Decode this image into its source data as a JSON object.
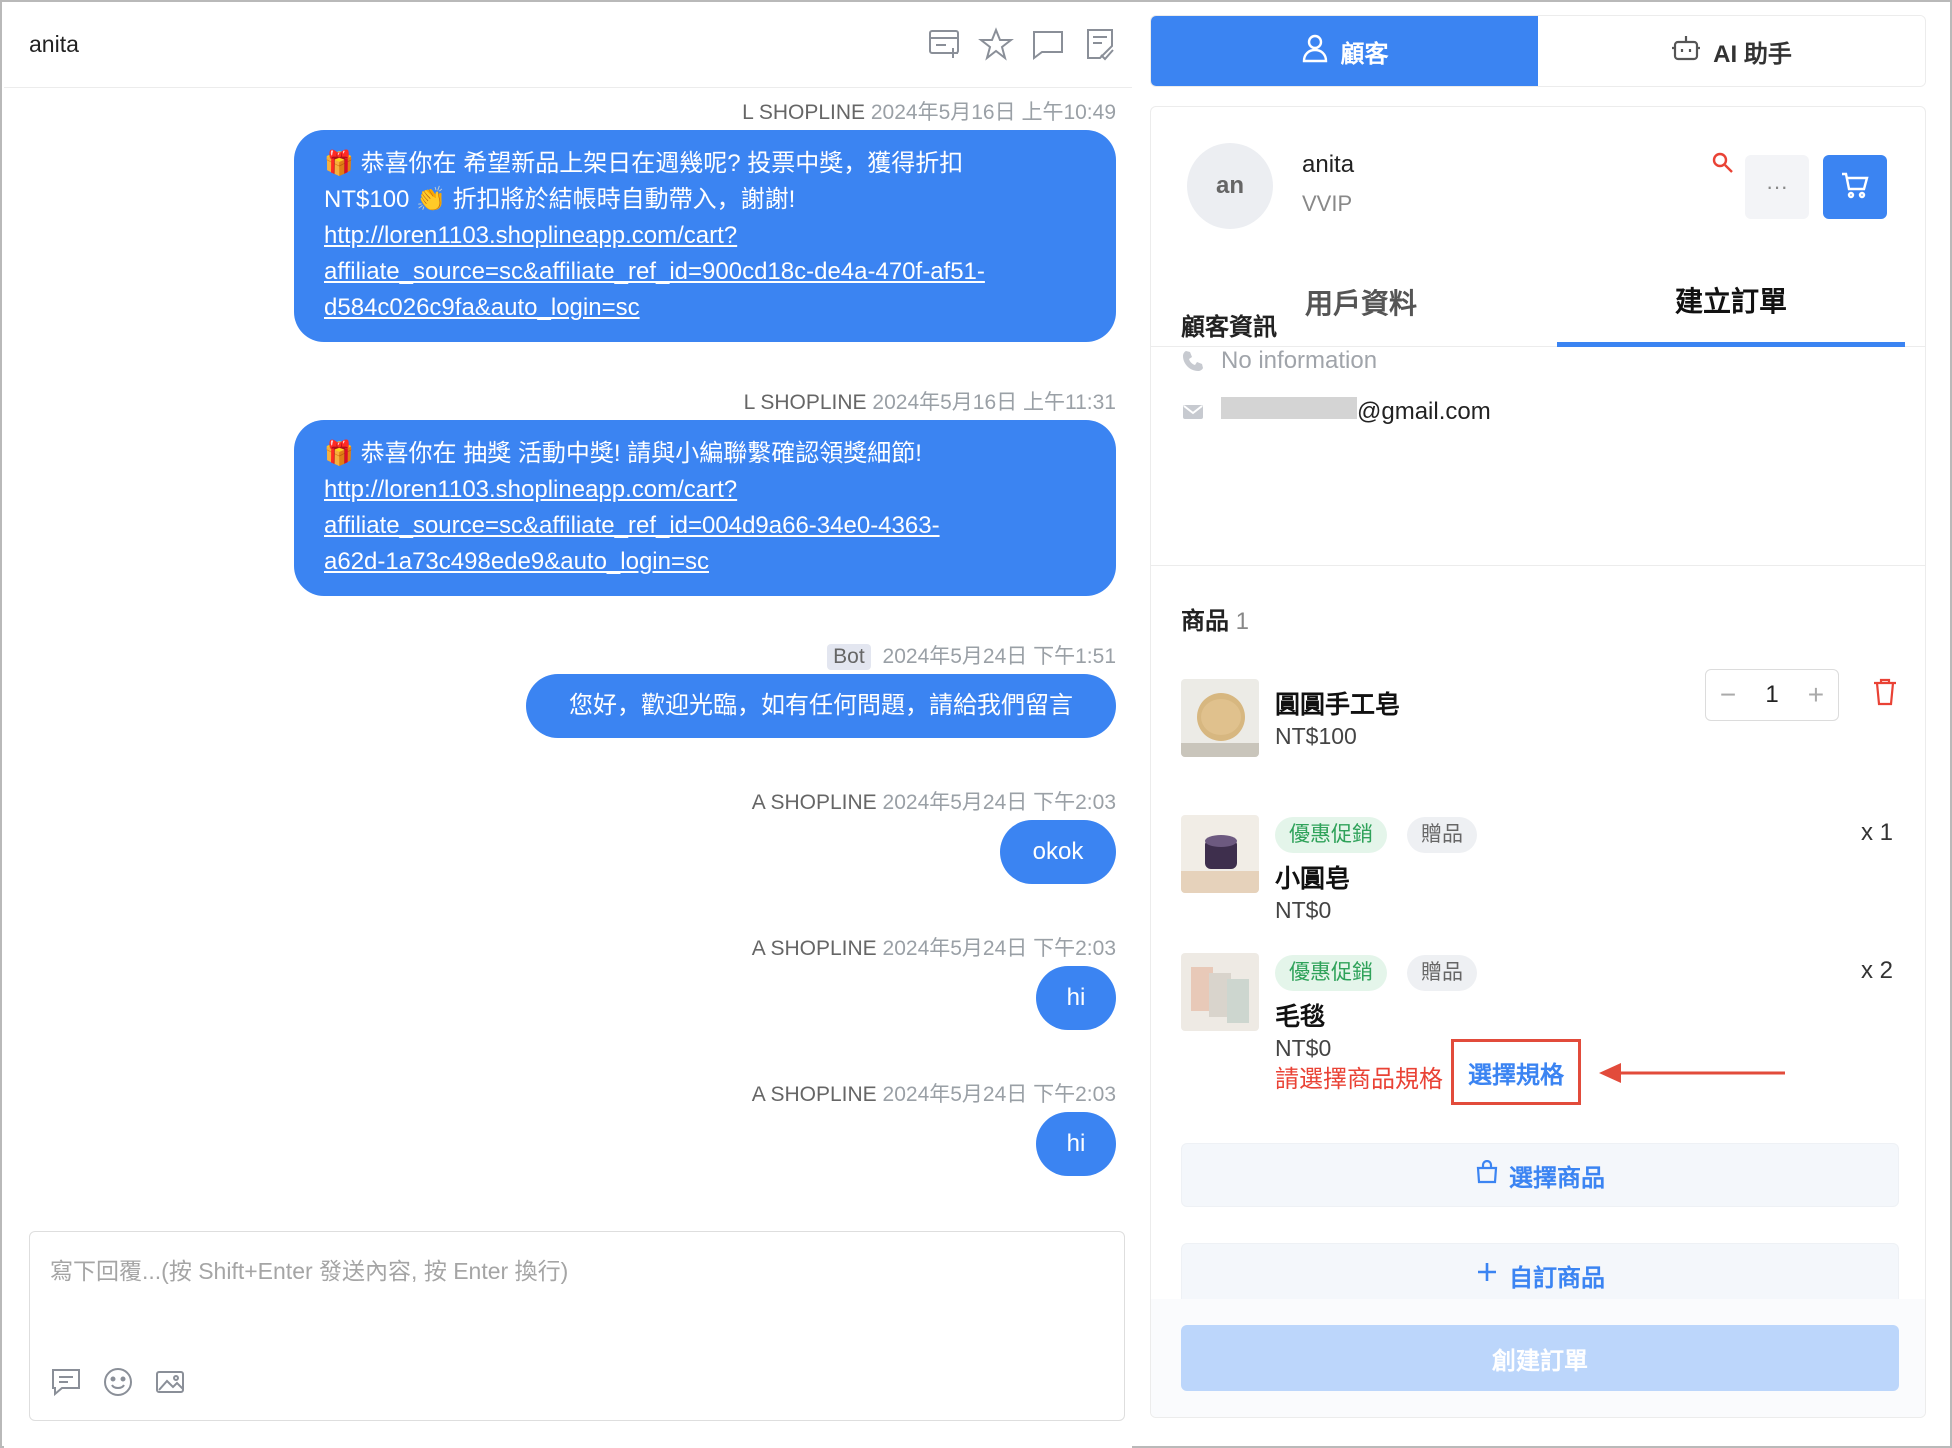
{
  "chat": {
    "contact_name": "anita",
    "messages": [
      {
        "sender": "L SHOPLINE",
        "time": "2024年5月16日 上午10:49",
        "text_lead": "恭喜你在 希望新品上架日在週幾呢? 投票中獎，獲得折扣",
        "text_cont": "NT$100",
        "text_after": "折扣將於結帳時自動帶入，謝謝!",
        "link": [
          "http://loren1103.shoplineapp.com/cart?",
          "affiliate_source=sc&affiliate_ref_id=900cd18c-de4a-470f-af51-",
          "d584c026c9fa&auto_login=sc"
        ]
      },
      {
        "sender": "L SHOPLINE",
        "time": "2024年5月16日 上午11:31",
        "text_lead": "恭喜你在 抽獎 活動中獎! 請與小編聯繫確認領獎細節!",
        "link": [
          "http://loren1103.shoplineapp.com/cart?",
          "affiliate_source=sc&affiliate_ref_id=004d9a66-34e0-4363-",
          "a62d-1a73c498ede9&auto_login=sc"
        ]
      },
      {
        "sender": "Bot",
        "time": "2024年5月24日 下午1:51",
        "text": "您好，歡迎光臨，如有任何問題，請給我們留言"
      },
      {
        "sender": "A SHOPLINE",
        "time": "2024年5月24日 下午2:03",
        "text": "okok"
      },
      {
        "sender": "A SHOPLINE",
        "time": "2024年5月24日 下午2:03",
        "text": "hi"
      },
      {
        "sender": "A SHOPLINE",
        "time": "2024年5月24日 下午2:03",
        "text": "hi"
      }
    ],
    "composer_placeholder": "寫下回覆...(按 Shift+Enter 發送內容, 按 Enter 換行)"
  },
  "top_tabs": {
    "customer": "顧客",
    "ai": "AI 助手"
  },
  "customer": {
    "avatar_initials": "an",
    "name": "anita",
    "tier": "VVIP",
    "more": "···"
  },
  "sub_tabs": {
    "profile": "用戶資料",
    "create_order": "建立訂單"
  },
  "customer_info": {
    "title": "顧客資訊",
    "phone": "No information",
    "email_suffix": "@gmail.com"
  },
  "products": {
    "title": "商品",
    "count": "1",
    "items": [
      {
        "name": "圓圓手工皂",
        "price": "NT$100",
        "quantity": "1"
      },
      {
        "name": "小圓皂",
        "price": "NT$0",
        "tag_promo": "優惠促銷",
        "tag_gift": "贈品",
        "qty_text": "x 1"
      },
      {
        "name": "毛毯",
        "price": "NT$0",
        "tag_promo": "優惠促銷",
        "tag_gift": "贈品",
        "qty_text": "x 2",
        "error": "請選擇商品規格",
        "action": "選擇規格"
      }
    ]
  },
  "buttons": {
    "select_product": "選擇商品",
    "custom_product": "自訂商品",
    "create_order": "創建訂單"
  },
  "colors": {
    "accent": "#3b84f2",
    "error": "#e94235",
    "promo": "#2fa25a",
    "highlight_box": "#e24b3b"
  },
  "icons": [
    "add-list-icon",
    "star-icon",
    "comment-icon",
    "note-icon",
    "user-icon",
    "robot-icon",
    "search-icon",
    "cart-icon",
    "phone-icon",
    "mail-icon",
    "trash-icon",
    "bag-icon",
    "plus-icon",
    "reply-template-icon",
    "emoji-icon",
    "image-icon",
    "gift-icon",
    "clap-icon"
  ]
}
